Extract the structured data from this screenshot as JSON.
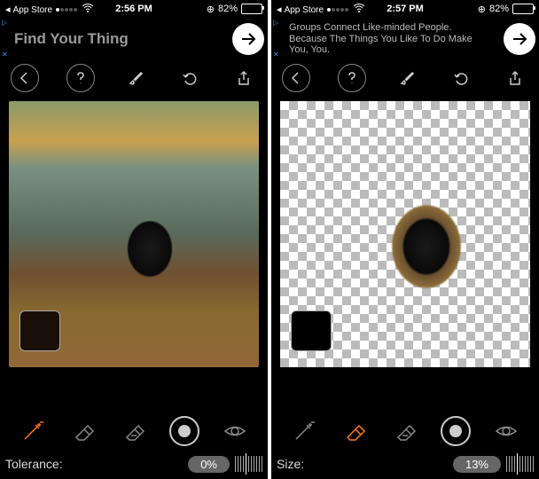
{
  "left": {
    "status": {
      "back_app": "App Store",
      "time": "2:56 PM",
      "battery_pct": "82%"
    },
    "ad": {
      "text": "Find Your Thing"
    },
    "swatch_color": "#1a0f08",
    "slider": {
      "label": "Tolerance:",
      "value": "0%"
    },
    "active_tool": "wand"
  },
  "right": {
    "status": {
      "back_app": "App Store",
      "time": "2:57 PM",
      "battery_pct": "82%"
    },
    "ad": {
      "text": "Groups Connect Like-minded People. Because The Things You Like To Do Make You, You."
    },
    "swatch_color": "#000000",
    "slider": {
      "label": "Size:",
      "value": "13%"
    },
    "active_tool": "eraser"
  },
  "icons": {
    "back": "back-icon",
    "help": "help-icon",
    "brush": "brush-settings-icon",
    "undo": "undo-icon",
    "share": "share-icon",
    "wand": "magic-wand-icon",
    "eraser": "eraser-icon",
    "restore": "restore-icon",
    "target": "target-icon",
    "eye": "preview-icon"
  }
}
